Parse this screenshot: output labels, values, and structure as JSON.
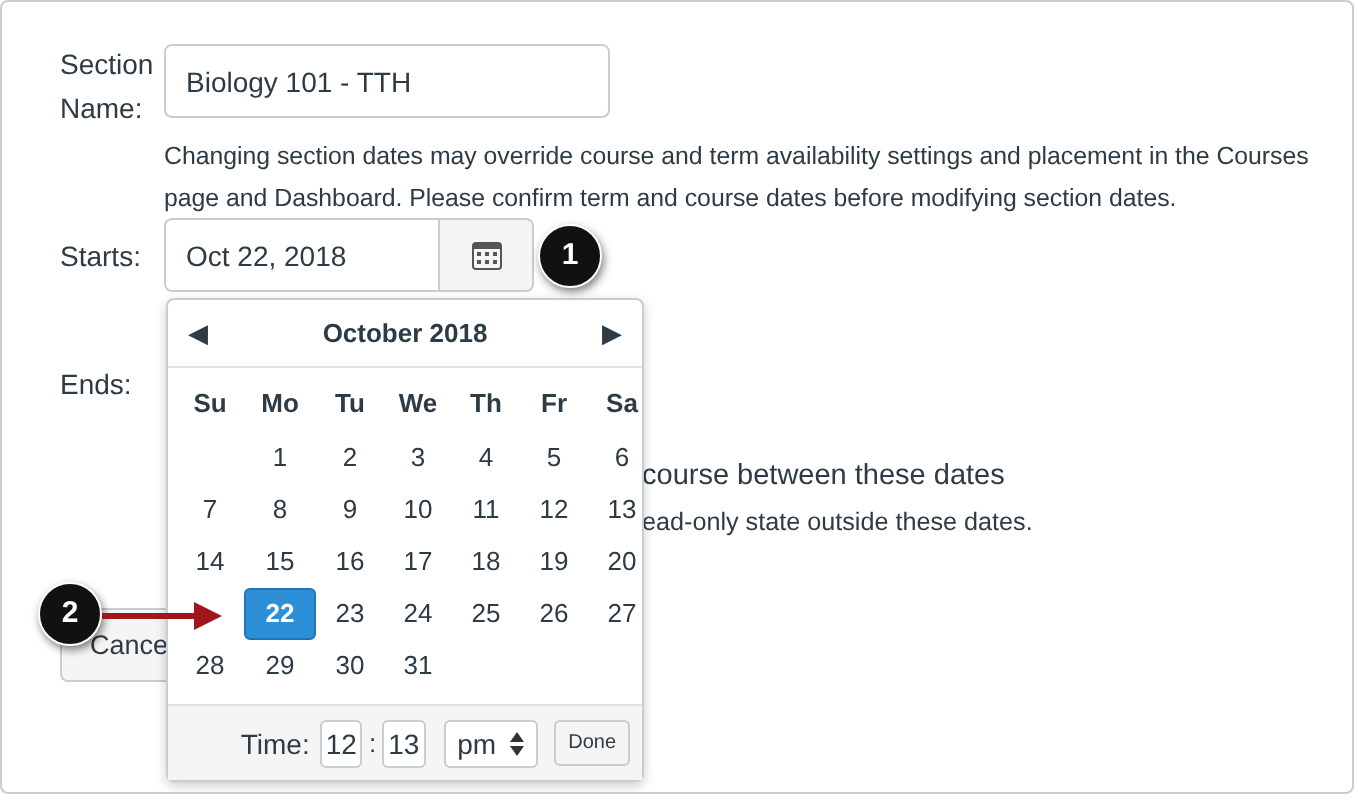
{
  "section_name": {
    "label": "Section Name:",
    "value": "Biology 101 - TTH"
  },
  "notice": "Changing section dates may override course and term availability settings and placement in the Courses page and Dashboard. Please confirm term and course dates before modifying section dates.",
  "starts": {
    "label": "Starts:",
    "value": "Oct 22, 2018"
  },
  "ends": {
    "label": "Ends:"
  },
  "restrict_text": "course between these dates",
  "restrict_note": "ead-only state outside these dates.",
  "cancel_button": "Cance",
  "calendar": {
    "prev": "◀",
    "title": "October 2018",
    "next": "▶",
    "weekdays": [
      "Su",
      "Mo",
      "Tu",
      "We",
      "Th",
      "Fr",
      "Sa"
    ],
    "weeks": [
      [
        {
          "kind": "blank"
        },
        {
          "kind": "day",
          "day": "1",
          "selected": false
        },
        {
          "kind": "day",
          "day": "2",
          "selected": false
        },
        {
          "kind": "day",
          "day": "3",
          "selected": false
        },
        {
          "kind": "day",
          "day": "4",
          "selected": false
        },
        {
          "kind": "day",
          "day": "5",
          "selected": false
        },
        {
          "kind": "day",
          "day": "6",
          "selected": false
        }
      ],
      [
        {
          "kind": "day",
          "day": "7",
          "selected": false
        },
        {
          "kind": "day",
          "day": "8",
          "selected": false
        },
        {
          "kind": "day",
          "day": "9",
          "selected": false
        },
        {
          "kind": "day",
          "day": "10",
          "selected": false
        },
        {
          "kind": "day",
          "day": "11",
          "selected": false
        },
        {
          "kind": "day",
          "day": "12",
          "selected": false
        },
        {
          "kind": "day",
          "day": "13",
          "selected": false
        }
      ],
      [
        {
          "kind": "day",
          "day": "14",
          "selected": false
        },
        {
          "kind": "day",
          "day": "15",
          "selected": false
        },
        {
          "kind": "day",
          "day": "16",
          "selected": false
        },
        {
          "kind": "day",
          "day": "17",
          "selected": false
        },
        {
          "kind": "day",
          "day": "18",
          "selected": false
        },
        {
          "kind": "day",
          "day": "19",
          "selected": false
        },
        {
          "kind": "day",
          "day": "20",
          "selected": false
        }
      ],
      [
        {
          "kind": "blank"
        },
        {
          "kind": "day",
          "day": "22",
          "selected": true
        },
        {
          "kind": "day",
          "day": "23",
          "selected": false
        },
        {
          "kind": "day",
          "day": "24",
          "selected": false
        },
        {
          "kind": "day",
          "day": "25",
          "selected": false
        },
        {
          "kind": "day",
          "day": "26",
          "selected": false
        },
        {
          "kind": "day",
          "day": "27",
          "selected": false
        }
      ],
      [
        {
          "kind": "day",
          "day": "28",
          "selected": false
        },
        {
          "kind": "day",
          "day": "29",
          "selected": false
        },
        {
          "kind": "day",
          "day": "30",
          "selected": false
        },
        {
          "kind": "day",
          "day": "31",
          "selected": false
        },
        {
          "kind": "blank"
        },
        {
          "kind": "blank"
        },
        {
          "kind": "blank"
        }
      ]
    ],
    "time_label": "Time:",
    "hour": "12",
    "separator": ":",
    "minute": "13",
    "ampm": "pm",
    "done": "Done"
  },
  "callouts": [
    "1",
    "2"
  ]
}
